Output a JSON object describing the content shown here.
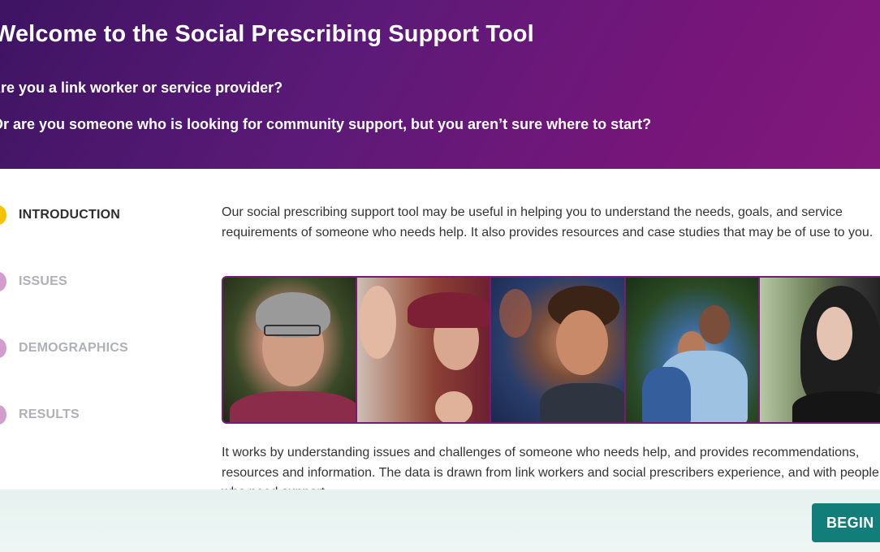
{
  "hero": {
    "title": "Welcome to the Social Prescribing Support Tool",
    "question1": "Are you a link worker or service provider?",
    "question2": "Or are you someone who is looking for community support, but you aren’t sure where to start?"
  },
  "steps": [
    {
      "label": "INTRODUCTION",
      "state": "active"
    },
    {
      "label": "ISSUES",
      "state": "inactive"
    },
    {
      "label": "DEMOGRAPHICS",
      "state": "inactive"
    },
    {
      "label": "RESULTS",
      "state": "inactive"
    }
  ],
  "content": {
    "paragraph1": "Our social prescribing support tool may be useful in helping you to understand the needs, goals, and service requirements of someone who needs help. It also provides resources and case studies that may be of use to you.",
    "paragraph2": "It works by understanding issues and challenges of someone who needs help, and provides recommendations, resources and information. The data is drawn from link workers and social prescribers experience, and with people who need support."
  },
  "footer": {
    "begin_label": "BEGIN →"
  },
  "colors": {
    "hero_start": "#3e1463",
    "hero_end": "#82187c",
    "active_step": "#f5c400",
    "inactive_step": "#d29ccc",
    "button": "#127e7a",
    "footer_bg": "#e6f2ef"
  }
}
